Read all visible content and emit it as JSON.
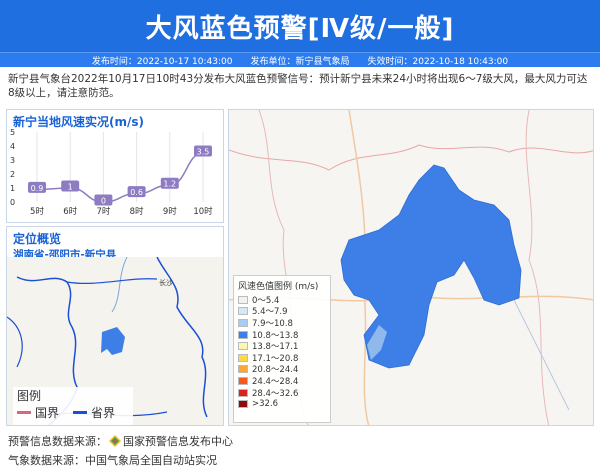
{
  "header": {
    "title": "大风蓝色预警[Ⅳ级/一般]"
  },
  "meta": {
    "publish_time": "发布时间：2022-10-17 10:43:00",
    "publisher": "发布单位：新宁县气象局",
    "expire_time": "失效时间：2022-10-18 10:43:00"
  },
  "description": "新宁县气象台2022年10月17日10时43分发布大风蓝色预警信号：预计新宁县未来24小时将出现6～7级大风，最大风力可达8级以上，请注意防范。",
  "wind_chart": {
    "title": "新宁当地风速实况(m/s)",
    "chart_data": {
      "type": "line",
      "categories": [
        "5时",
        "6时",
        "7时",
        "8时",
        "9时",
        "10时"
      ],
      "values": [
        0.9,
        1,
        0,
        0.6,
        1.2,
        3.5
      ],
      "value_labels": [
        "0.9",
        "1",
        "0",
        "0.6",
        "1.2",
        "3.5"
      ],
      "yticks": [
        "0",
        "1",
        "2",
        "3",
        "4",
        "5"
      ],
      "ylim": [
        0,
        5
      ],
      "color": "#8e7cc3"
    }
  },
  "location": {
    "title": "定位概览",
    "region": "湖南省-邵阳市-新宁县",
    "city_label": "长沙",
    "legend_title": "图例",
    "legend_guo": "国界",
    "legend_sheng": "省界"
  },
  "map_legend": {
    "title": "风速色值图例 (m/s)",
    "items": [
      {
        "label": "0～5.4",
        "color": "#f2f2f2"
      },
      {
        "label": "5.4～7.9",
        "color": "#d4e8f8"
      },
      {
        "label": "7.9～10.8",
        "color": "#a7cdf2"
      },
      {
        "label": "10.8～13.8",
        "color": "#3d7fe6"
      },
      {
        "label": "13.8～17.1",
        "color": "#fff6b0"
      },
      {
        "label": "17.1～20.8",
        "color": "#ffd84a"
      },
      {
        "label": "20.8～24.4",
        "color": "#ffa531"
      },
      {
        "label": "24.4～28.4",
        "color": "#f55b1d"
      },
      {
        "label": "28.4～32.6",
        "color": "#d9231c"
      },
      {
        "label": ">32.6",
        "color": "#8b0c0c"
      }
    ]
  },
  "footer": {
    "warning_source_label": "预警信息数据来源：",
    "warning_source": "国家预警信息发布中心",
    "weather_source_label": "气象数据来源：",
    "weather_source": "中国气象局全国自动站实况"
  },
  "colors": {
    "header_bg": "#1f6fe0",
    "accent": "#1a63d6",
    "region_fill": "#3d7fe6"
  }
}
